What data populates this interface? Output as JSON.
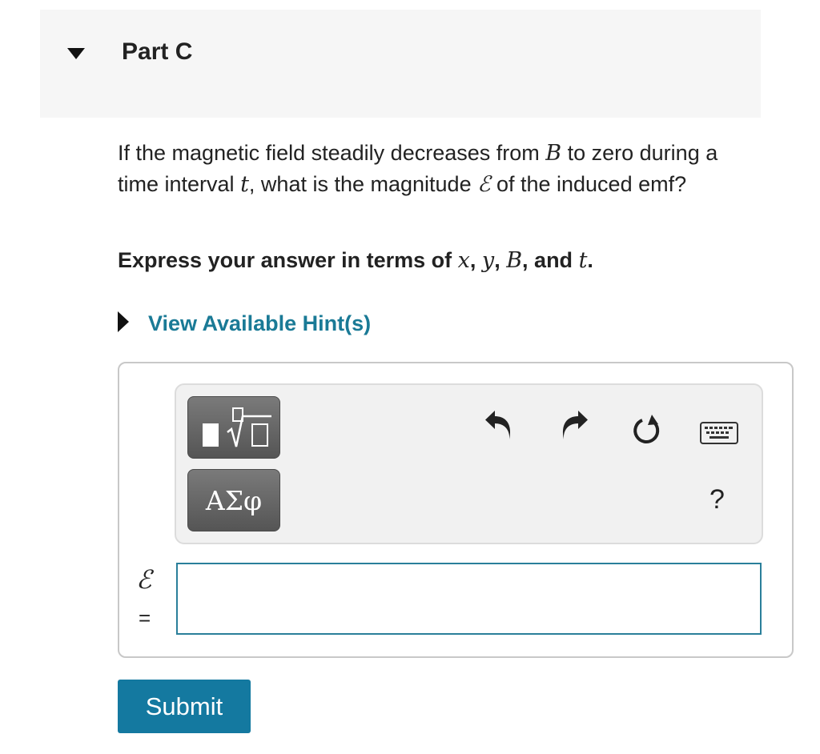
{
  "part": {
    "title": "Part C"
  },
  "question": {
    "t1": "If the magnetic field steadily decreases from ",
    "v1": "B",
    "t2": " to zero during a time interval ",
    "v2": "t",
    "t3": ", what is the magnitude ",
    "v3": "ℰ",
    "t4": " of the induced emf?"
  },
  "instruction": {
    "t1": "Express your answer in terms of ",
    "v1": "x",
    "s1": ", ",
    "v2": "y",
    "s2": ", ",
    "v3": "B",
    "s3": ", and ",
    "v4": "t",
    "s4": "."
  },
  "hint": {
    "label": "View Available Hint(s)"
  },
  "toolbar": {
    "greek_label": "ΑΣφ",
    "help_label": "?",
    "icons": [
      "templates-icon",
      "greek-symbols",
      "undo-icon",
      "redo-icon",
      "reset-icon",
      "keyboard-icon"
    ]
  },
  "answer": {
    "symbol": "ℰ",
    "equals": "=",
    "value": ""
  },
  "submit": {
    "label": "Submit"
  },
  "colors": {
    "link": "#1a7a96",
    "submit_bg": "#1479a0",
    "input_border": "#2a7f9a"
  }
}
